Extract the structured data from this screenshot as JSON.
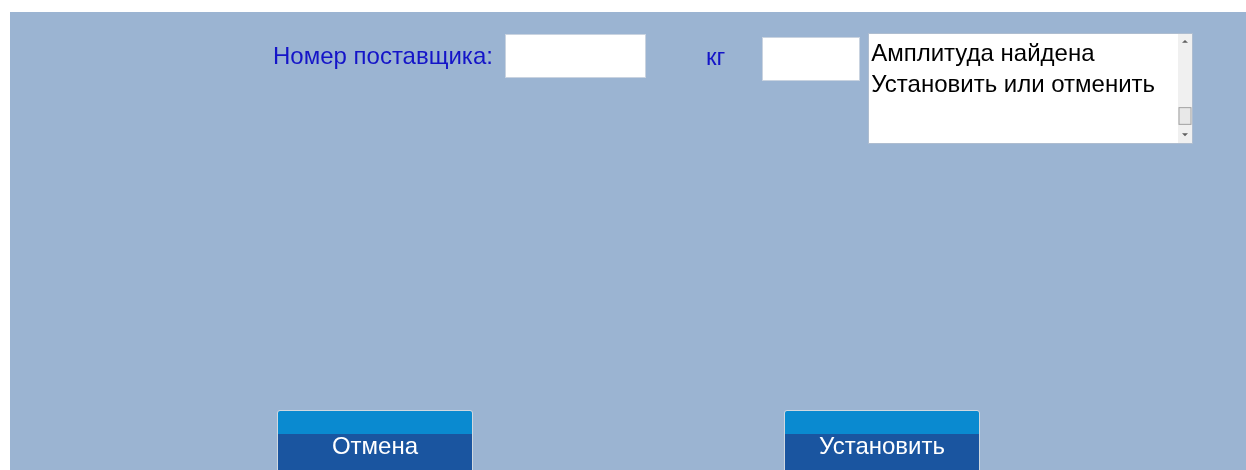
{
  "supplier_label": "Номер поставщика:",
  "weight_label": "кг",
  "message_lines": [
    "Амплитуда найдена",
    "Установить или отменить"
  ],
  "buttons": [
    {
      "label": "Отмена"
    },
    {
      "label": "Установить"
    }
  ]
}
